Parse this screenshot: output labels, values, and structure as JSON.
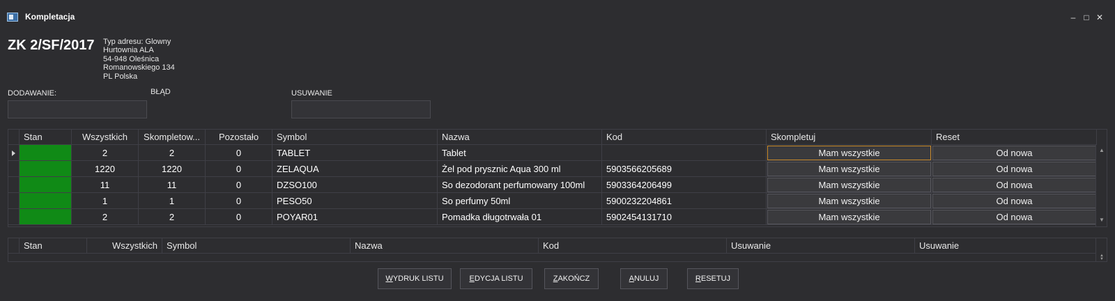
{
  "window": {
    "title": "Kompletacja",
    "icon": "app-window-icon",
    "controls": {
      "minimize": "–",
      "maximize": "□",
      "close": "✕"
    }
  },
  "document": {
    "number": "ZK 2/SF/2017",
    "address_lines": [
      "Typ adresu: Glowny",
      "Hurtownia ALA",
      "54-948 Oleśnica",
      "Romanowskiego 134",
      "PL Polska"
    ]
  },
  "fields": {
    "adding_label": "DODAWANIE:",
    "adding_value": "",
    "error_label": "BŁĄD",
    "removing_label": "USUWANIE",
    "removing_value": ""
  },
  "main_grid": {
    "columns": [
      "Stan",
      "Wszystkich",
      "Skompletow...",
      "Pozostało",
      "Symbol",
      "Nazwa",
      "Kod",
      "Skompletuj",
      "Reset"
    ],
    "rows": [
      {
        "all": "2",
        "completed": "2",
        "remaining": "0",
        "symbol": "TABLET",
        "name": "Tablet",
        "code": "",
        "complete_btn": "Mam wszystkie",
        "reset_btn": "Od nowa"
      },
      {
        "all": "1220",
        "completed": "1220",
        "remaining": "0",
        "symbol": "ZELAQUA",
        "name": "Żel pod prysznic Aqua 300 ml",
        "code": "5903566205689",
        "complete_btn": "Mam wszystkie",
        "reset_btn": "Od nowa"
      },
      {
        "all": "11",
        "completed": "11",
        "remaining": "0",
        "symbol": "DZSO100",
        "name": "So dezodorant perfumowany 100ml",
        "code": "5903364206499",
        "complete_btn": "Mam wszystkie",
        "reset_btn": "Od nowa"
      },
      {
        "all": "1",
        "completed": "1",
        "remaining": "0",
        "symbol": "PESO50",
        "name": "So perfumy 50ml",
        "code": "5900232204861",
        "complete_btn": "Mam wszystkie",
        "reset_btn": "Od nowa"
      },
      {
        "all": "2",
        "completed": "2",
        "remaining": "0",
        "symbol": "POYAR01",
        "name": "Pomadka długotrwała 01",
        "code": "5902454131710",
        "complete_btn": "Mam wszystkie",
        "reset_btn": "Od nowa"
      }
    ],
    "status_color": "#108a16"
  },
  "removal_grid": {
    "columns": [
      "Stan",
      "Wszystkich",
      "Symbol",
      "Nazwa",
      "Kod",
      "Usuwanie",
      "Usuwanie"
    ]
  },
  "actions": {
    "print": {
      "pre": "",
      "ul": "W",
      "post": "YDRUK LISTU"
    },
    "edit": {
      "pre": "",
      "ul": "E",
      "post": "DYCJA LISTU"
    },
    "finish": {
      "pre": "",
      "ul": "Z",
      "post": "AKOŃCZ"
    },
    "cancel": {
      "pre": "",
      "ul": "A",
      "post": "NULUJ"
    },
    "reset": {
      "pre": "",
      "ul": "R",
      "post": "ESETUJ"
    }
  }
}
